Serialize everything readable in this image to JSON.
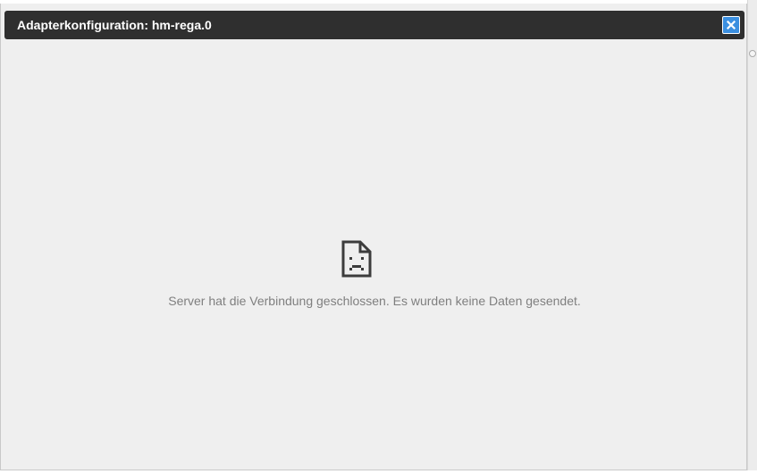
{
  "dialog": {
    "title": "Adapterkonfiguration: hm-rega.0",
    "close_icon": "close-icon",
    "accent_color": "#3b8fe0",
    "titlebar_color": "#2f2f2f"
  },
  "error": {
    "icon": "sad-page-icon",
    "message": "Server hat die Verbindung geschlossen. Es wurden keine Daten gesendet."
  }
}
